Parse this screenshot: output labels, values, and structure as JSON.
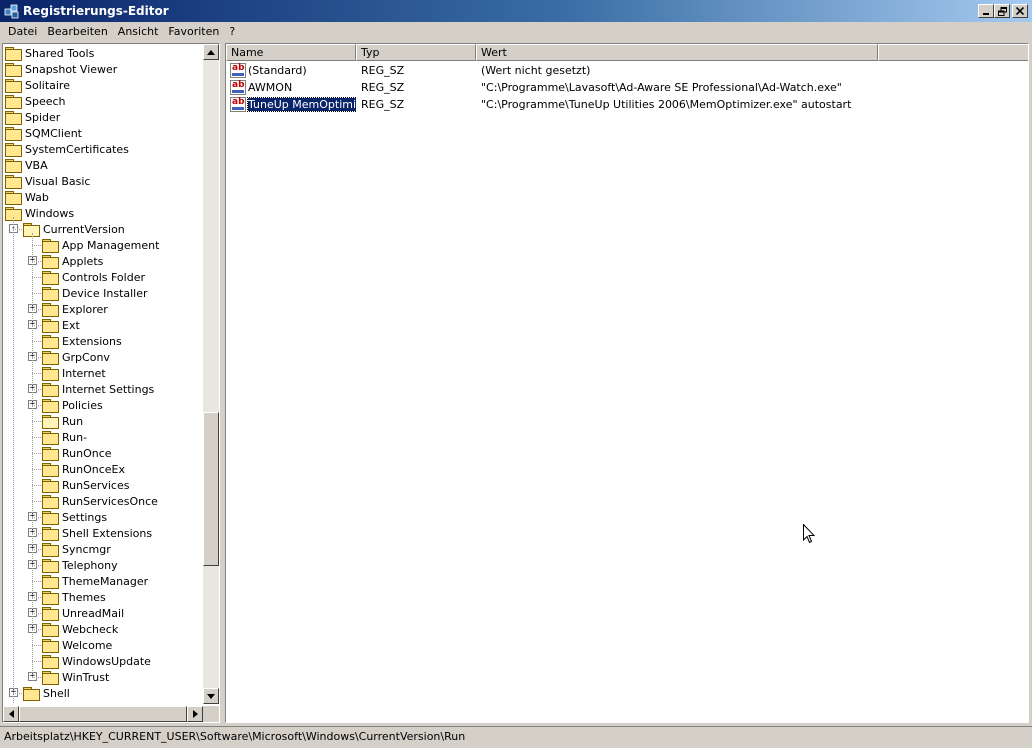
{
  "window": {
    "title": "Registrierungs-Editor"
  },
  "menu": {
    "items": [
      "Datei",
      "Bearbeiten",
      "Ansicht",
      "Favoriten",
      "?"
    ]
  },
  "tree": {
    "nodes": [
      {
        "label": "Shared Tools",
        "level": 0,
        "expander": ""
      },
      {
        "label": "Snapshot Viewer",
        "level": 0,
        "expander": ""
      },
      {
        "label": "Solitaire",
        "level": 0,
        "expander": ""
      },
      {
        "label": "Speech",
        "level": 0,
        "expander": ""
      },
      {
        "label": "Spider",
        "level": 0,
        "expander": ""
      },
      {
        "label": "SQMClient",
        "level": 0,
        "expander": ""
      },
      {
        "label": "SystemCertificates",
        "level": 0,
        "expander": ""
      },
      {
        "label": "VBA",
        "level": 0,
        "expander": ""
      },
      {
        "label": "Visual Basic",
        "level": 0,
        "expander": ""
      },
      {
        "label": "Wab",
        "level": 0,
        "expander": ""
      },
      {
        "label": "Windows",
        "level": 0,
        "expander": ""
      },
      {
        "label": "CurrentVersion",
        "level": 1,
        "expander": "-",
        "open": true
      },
      {
        "label": "App Management",
        "level": 2,
        "expander": ""
      },
      {
        "label": "Applets",
        "level": 2,
        "expander": "+"
      },
      {
        "label": "Controls Folder",
        "level": 2,
        "expander": ""
      },
      {
        "label": "Device Installer",
        "level": 2,
        "expander": ""
      },
      {
        "label": "Explorer",
        "level": 2,
        "expander": "+"
      },
      {
        "label": "Ext",
        "level": 2,
        "expander": "+"
      },
      {
        "label": "Extensions",
        "level": 2,
        "expander": ""
      },
      {
        "label": "GrpConv",
        "level": 2,
        "expander": "+"
      },
      {
        "label": "Internet",
        "level": 2,
        "expander": ""
      },
      {
        "label": "Internet Settings",
        "level": 2,
        "expander": "+"
      },
      {
        "label": "Policies",
        "level": 2,
        "expander": "+"
      },
      {
        "label": "Run",
        "level": 2,
        "expander": "",
        "open": true
      },
      {
        "label": "Run-",
        "level": 2,
        "expander": ""
      },
      {
        "label": "RunOnce",
        "level": 2,
        "expander": ""
      },
      {
        "label": "RunOnceEx",
        "level": 2,
        "expander": ""
      },
      {
        "label": "RunServices",
        "level": 2,
        "expander": ""
      },
      {
        "label": "RunServicesOnce",
        "level": 2,
        "expander": ""
      },
      {
        "label": "Settings",
        "level": 2,
        "expander": "+"
      },
      {
        "label": "Shell Extensions",
        "level": 2,
        "expander": "+"
      },
      {
        "label": "Syncmgr",
        "level": 2,
        "expander": "+"
      },
      {
        "label": "Telephony",
        "level": 2,
        "expander": "+"
      },
      {
        "label": "ThemeManager",
        "level": 2,
        "expander": ""
      },
      {
        "label": "Themes",
        "level": 2,
        "expander": "+"
      },
      {
        "label": "UnreadMail",
        "level": 2,
        "expander": "+"
      },
      {
        "label": "Webcheck",
        "level": 2,
        "expander": "+"
      },
      {
        "label": "Welcome",
        "level": 2,
        "expander": ""
      },
      {
        "label": "WindowsUpdate",
        "level": 2,
        "expander": ""
      },
      {
        "label": "WinTrust",
        "level": 2,
        "expander": "+"
      },
      {
        "label": "Shell",
        "level": 1,
        "expander": "+"
      }
    ]
  },
  "list": {
    "columns": [
      "Name",
      "Typ",
      "Wert"
    ],
    "rows": [
      {
        "name": "(Standard)",
        "type": "REG_SZ",
        "value": "(Wert nicht gesetzt)",
        "selected": false
      },
      {
        "name": "AWMON",
        "type": "REG_SZ",
        "value": "\"C:\\Programme\\Lavasoft\\Ad-Aware SE Professional\\Ad-Watch.exe\"",
        "selected": false
      },
      {
        "name": "TuneUp MemOptimi...",
        "type": "REG_SZ",
        "value": "\"C:\\Programme\\TuneUp Utilities 2006\\MemOptimizer.exe\" autostart",
        "selected": true
      }
    ]
  },
  "status": {
    "path": "Arbeitsplatz\\HKEY_CURRENT_USER\\Software\\Microsoft\\Windows\\CurrentVersion\\Run"
  },
  "icons": {
    "app": "registry-editor-icon",
    "folder": "folder-icon",
    "value": "string-value-icon"
  }
}
